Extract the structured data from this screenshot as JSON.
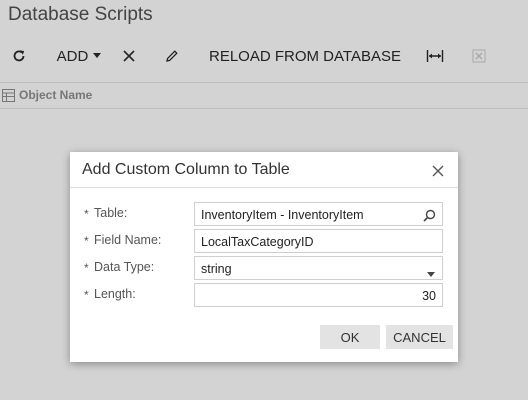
{
  "page": {
    "title": "Database Scripts"
  },
  "toolbar": {
    "refresh_icon": "refresh-icon",
    "add_label": "ADD",
    "add_dropdown_icon": "caret-down-icon",
    "delete_icon": "close-icon",
    "edit_icon": "pencil-icon",
    "reload_label": "RELOAD FROM DATABASE",
    "fit_icon": "fit-width-icon",
    "export_icon": "excel-export-icon"
  },
  "grid": {
    "column_icon": "column-settings-icon",
    "columns": [
      "Object Name"
    ]
  },
  "dialog": {
    "title": "Add Custom Column to Table",
    "close_icon": "close-icon",
    "required_mark": "*",
    "fields": [
      {
        "label": "Table:",
        "value": "InventoryItem - InventoryItem",
        "icon": "search-icon"
      },
      {
        "label": "Field Name:",
        "value": "LocalTaxCategoryID"
      },
      {
        "label": "Data Type:",
        "value": "string",
        "icon": "caret-down-icon"
      },
      {
        "label": "Length:",
        "value": "30"
      }
    ],
    "ok_label": "OK",
    "cancel_label": "CANCEL"
  },
  "colors": {
    "background": "#d3d3d3",
    "dialog_bg": "#ffffff",
    "button_bg": "#e3e3e3",
    "text": "#333333"
  }
}
